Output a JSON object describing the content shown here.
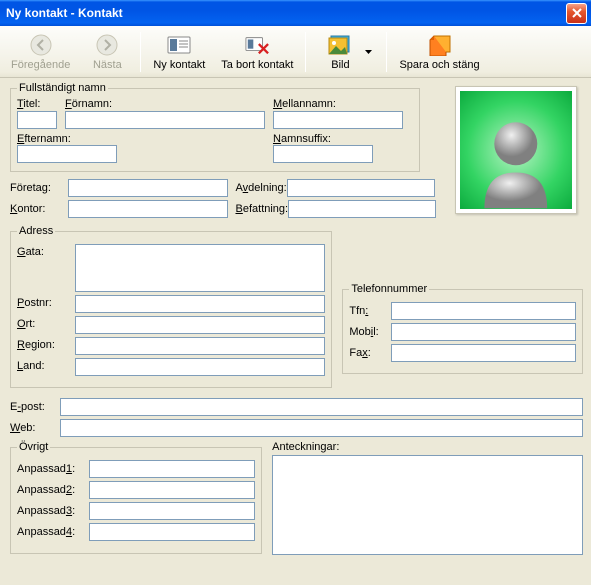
{
  "window": {
    "title": "Ny kontakt - Kontakt"
  },
  "toolbar": {
    "prev": "Föregående",
    "next": "Nästa",
    "new_contact": "Ny kontakt",
    "delete_contact": "Ta bort kontakt",
    "image": "Bild",
    "save_close": "Spara och stäng"
  },
  "groups": {
    "fullname": "Fullständigt namn",
    "address": "Adress",
    "phone": "Telefonnummer",
    "misc": "Övrigt"
  },
  "labels": {
    "title": "Titel:",
    "firstname": "Förnamn:",
    "middlename": "Mellannamn:",
    "lastname": "Efternamn:",
    "suffix": "Namnsuffix:",
    "company": "Företag:",
    "office": "Kontor:",
    "department": "Avdelning:",
    "position": "Befattning:",
    "street": "Gata:",
    "zip": "Postnr:",
    "city": "Ort:",
    "region": "Region:",
    "country": "Land:",
    "phone_short": "Tfn:",
    "mobile": "Mobil:",
    "fax": "Fax:",
    "email": "E-post:",
    "web": "Web:",
    "custom1": "Anpassad1:",
    "custom2": "Anpassad2:",
    "custom3": "Anpassad3:",
    "custom4": "Anpassad4:",
    "notes": "Anteckningar:"
  },
  "values": {
    "title": "",
    "firstname": "",
    "middlename": "",
    "lastname": "",
    "suffix": "",
    "company": "",
    "office": "",
    "department": "",
    "position": "",
    "street": "",
    "zip": "",
    "city": "",
    "region": "",
    "country": "",
    "phone": "",
    "mobile": "",
    "fax": "",
    "email": "",
    "web": "",
    "custom1": "",
    "custom2": "",
    "custom3": "",
    "custom4": "",
    "notes": ""
  }
}
